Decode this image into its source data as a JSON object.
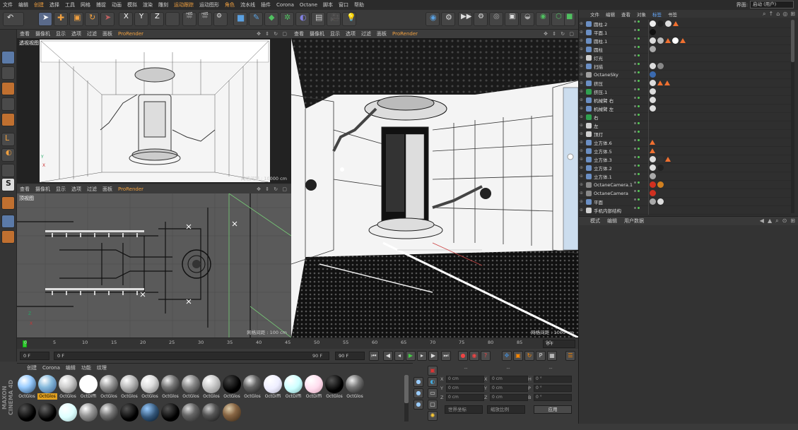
{
  "menu": [
    "文件",
    "编辑",
    "创建",
    "选择",
    "工具",
    "网格",
    "捕捉",
    "动画",
    "模拟",
    "渲染",
    "雕刻",
    "运动跟踪",
    "运动图形",
    "角色",
    "流水线",
    "插件",
    "Corona",
    "Octane",
    "脚本",
    "窗口",
    "帮助"
  ],
  "menu_highlight": [
    "创建",
    "运动跟踪",
    "角色"
  ],
  "layout_label": "界面:",
  "layout_value": "启动 (用户)",
  "viewport_menu": [
    "查看",
    "摄像机",
    "显示",
    "选项",
    "过滤",
    "面板",
    "ProRender"
  ],
  "viewports": {
    "tl_label": "透视视图",
    "tl_grid": "网格间距 : 10000 cm",
    "bl_label": "顶视图",
    "bl_grid": "网格间距 : 100 cm",
    "right_grid": "网格间距 : 1000 cm"
  },
  "timeline": {
    "ticks": [
      "0",
      "5",
      "10",
      "15",
      "20",
      "25",
      "30",
      "35",
      "40",
      "45",
      "50",
      "55",
      "60",
      "65",
      "70",
      "75",
      "80",
      "85",
      "90"
    ],
    "current": "0",
    "end_label": "0 F"
  },
  "transport": {
    "start": "0 F",
    "min": "0 F",
    "max": "90 F",
    "end": "90 F"
  },
  "material_tabs": [
    "创建",
    "Corona",
    "编辑",
    "功能",
    "纹理"
  ],
  "materials_row1": [
    "OctGlos",
    "OctGlos",
    "OctGlos",
    "OctDiffi",
    "OctGlos",
    "OctGlos",
    "OctGlos",
    "OctGlos",
    "OctGlos",
    "OctGlos",
    "OctGlos",
    "OctGlos",
    "OctDiffi",
    "OctDiffi",
    "OctDiffi",
    "OctGlos",
    "OctGlos"
  ],
  "materials_row2": [
    "OctGlos",
    "OctGlos",
    "OctGlos",
    "OctGlos",
    "OctGlos",
    "OctGlos",
    "OctGlos",
    "OctGlos",
    "OctGlos",
    "OctGlos",
    "OctGlos"
  ],
  "selected_material_index": 1,
  "coords": {
    "headers": [
      "--",
      "--",
      "--"
    ],
    "rows": [
      {
        "l1": "X",
        "v1": "0 cm",
        "l2": "X",
        "v2": "0 cm",
        "l3": "H",
        "v3": "0 °"
      },
      {
        "l1": "Y",
        "v1": "0 cm",
        "l2": "Y",
        "v2": "0 cm",
        "l3": "P",
        "v3": "0 °"
      },
      {
        "l1": "Z",
        "v1": "0 cm",
        "l2": "Z",
        "v2": "0 cm",
        "l3": "B",
        "v3": "0 °"
      }
    ],
    "mode1": "世界坐标",
    "mode2": "缩放比例",
    "apply": "应用"
  },
  "object_tabs": [
    "文件",
    "编辑",
    "查看",
    "对象",
    "标签",
    "书签"
  ],
  "objects": [
    {
      "name": "圆柱.2",
      "color": "#6b8fc4",
      "tags": [
        "#eee",
        "#222",
        "#ddd",
        "#f07030"
      ]
    },
    {
      "name": "平面.1",
      "color": "#6b8fc4",
      "tags": [
        "#111"
      ]
    },
    {
      "name": "圆柱.1",
      "color": "#6b8fc4",
      "tags": [
        "#ddd",
        "#bbb",
        "#f07030",
        "#fff",
        "#f07030"
      ]
    },
    {
      "name": "圆柱",
      "color": "#6b8fc4",
      "tags": [
        "#aaa"
      ]
    },
    {
      "name": "灯光",
      "color": "#d0d0d0",
      "tags": []
    },
    {
      "name": "扫描",
      "color": "#6b8fc4",
      "tags": [
        "#ddd",
        "#888"
      ]
    },
    {
      "name": "OctaneSky",
      "color": "#a0a0a0",
      "tags": [
        "#3a6ab0"
      ]
    },
    {
      "name": "挤压",
      "color": "#6b8fc4",
      "tags": [
        "#ddd",
        "#f07030",
        "#f07030"
      ]
    },
    {
      "name": "挤压.1",
      "color": "#30a050",
      "tags": [
        "#ddd"
      ]
    },
    {
      "name": "机械臂 右",
      "color": "#6b8fc4",
      "tags": [
        "#ddd"
      ]
    },
    {
      "name": "机械臂 左",
      "color": "#6b8fc4",
      "tags": [
        "#ddd"
      ]
    },
    {
      "name": "右",
      "color": "#30a050",
      "tags": []
    },
    {
      "name": "左",
      "color": "#d0d0d0",
      "tags": []
    },
    {
      "name": "顶灯",
      "color": "#d0d0d0",
      "tags": []
    },
    {
      "name": "立方体.6",
      "color": "#6b8fc4",
      "tags": [
        "#f07030"
      ]
    },
    {
      "name": "立方体.5",
      "color": "#6b8fc4",
      "tags": [
        "#f07030"
      ]
    },
    {
      "name": "立方体.3",
      "color": "#6b8fc4",
      "tags": [
        "#ddd",
        "#333",
        "#f07030"
      ]
    },
    {
      "name": "立方体.2",
      "color": "#6b8fc4",
      "tags": [
        "#ddd",
        "#222"
      ]
    },
    {
      "name": "立方体.1",
      "color": "#6b8fc4",
      "tags": [
        "#aaa"
      ]
    },
    {
      "name": "OctaneCamera.1",
      "color": "#888",
      "tags": [
        "#d03020",
        "#d08020"
      ]
    },
    {
      "name": "OctaneCamera",
      "color": "#888",
      "tags": [
        "#d03020"
      ]
    },
    {
      "name": "平面",
      "color": "#6b8fc4",
      "tags": [
        "#aaa",
        "#ddd"
      ]
    },
    {
      "name": "手机内部结构",
      "color": "#d0d0d0",
      "tags": []
    }
  ],
  "attr_tabs": [
    "模式",
    "编辑",
    "用户数据"
  ],
  "brand": "MAXON CINEMA 4D"
}
